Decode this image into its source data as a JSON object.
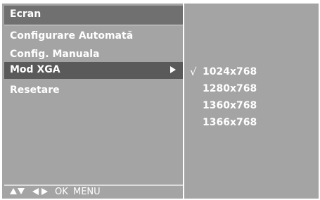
{
  "title": "Ecran",
  "menu": [
    {
      "label": "Configurare Automată",
      "selected": false
    },
    {
      "label": "Config. Manuala",
      "selected": false
    },
    {
      "label": "Mod XGA",
      "selected": true
    },
    {
      "label": "Resetare",
      "selected": false
    }
  ],
  "submenu": {
    "check_mark": "√",
    "options": [
      {
        "label": "1024x768",
        "checked": true
      },
      {
        "label": "1280x768",
        "checked": false
      },
      {
        "label": "1360x768",
        "checked": false
      },
      {
        "label": "1366x768",
        "checked": false
      }
    ]
  },
  "nav_hints": {
    "ok_label": "OK",
    "menu_label": "MENU",
    "icons": [
      "up-arrow-icon",
      "down-arrow-icon",
      "left-arrow-icon",
      "right-arrow-icon"
    ]
  },
  "colors": {
    "panel": "#a4a4a4",
    "title_bar": "#707070",
    "selected_row": "#5a5a5a",
    "text": "#ffffff"
  }
}
